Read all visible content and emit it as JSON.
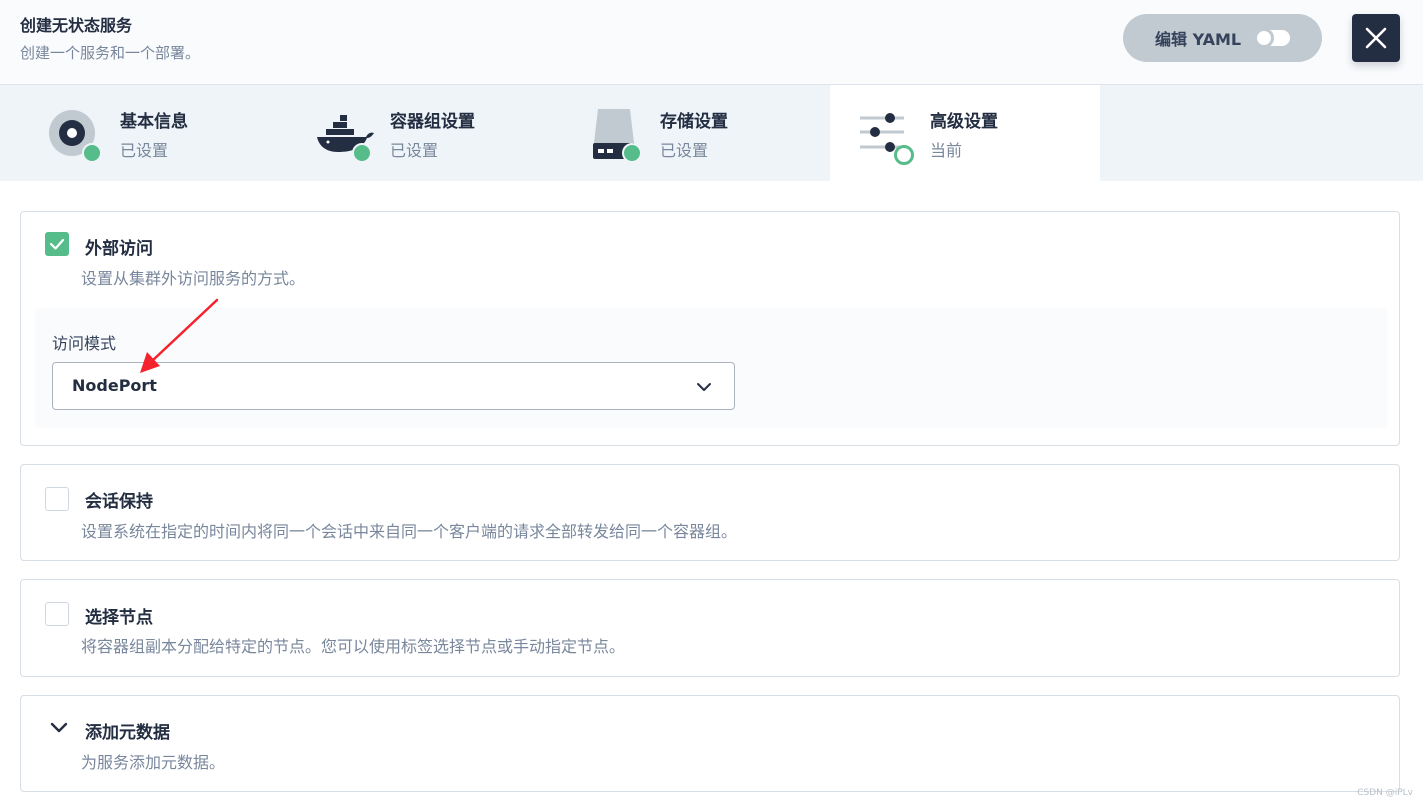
{
  "header": {
    "title": "创建无状态服务",
    "description": "创建一个服务和一个部署。",
    "yaml_label": "编辑 YAML",
    "close_icon": "close-icon"
  },
  "steps": [
    {
      "title": "基本信息",
      "status": "已设置",
      "icon": "disk-icon"
    },
    {
      "title": "容器组设置",
      "status": "已设置",
      "icon": "docker-icon"
    },
    {
      "title": "存储设置",
      "status": "已设置",
      "icon": "storage-icon"
    },
    {
      "title": "高级设置",
      "status": "当前",
      "icon": "sliders-icon"
    }
  ],
  "sections": {
    "external_access": {
      "checked": true,
      "title": "外部访问",
      "description": "设置从集群外访问服务的方式。",
      "field_label": "访问模式",
      "selected_value": "NodePort"
    },
    "session_affinity": {
      "checked": false,
      "title": "会话保持",
      "description": "设置系统在指定的时间内将同一个会话中来自同一个客户端的请求全部转发给同一个容器组。"
    },
    "node_selector": {
      "checked": false,
      "title": "选择节点",
      "description": "将容器组副本分配给特定的节点。您可以使用标签选择节点或手动指定节点。"
    },
    "metadata": {
      "title": "添加元数据",
      "description": "为服务添加元数据。"
    }
  },
  "watermark": "CSDN @iPLv",
  "colors": {
    "accent": "#55bc8a",
    "dark": "#242e42",
    "annotation_arrow": "#f5222d"
  }
}
